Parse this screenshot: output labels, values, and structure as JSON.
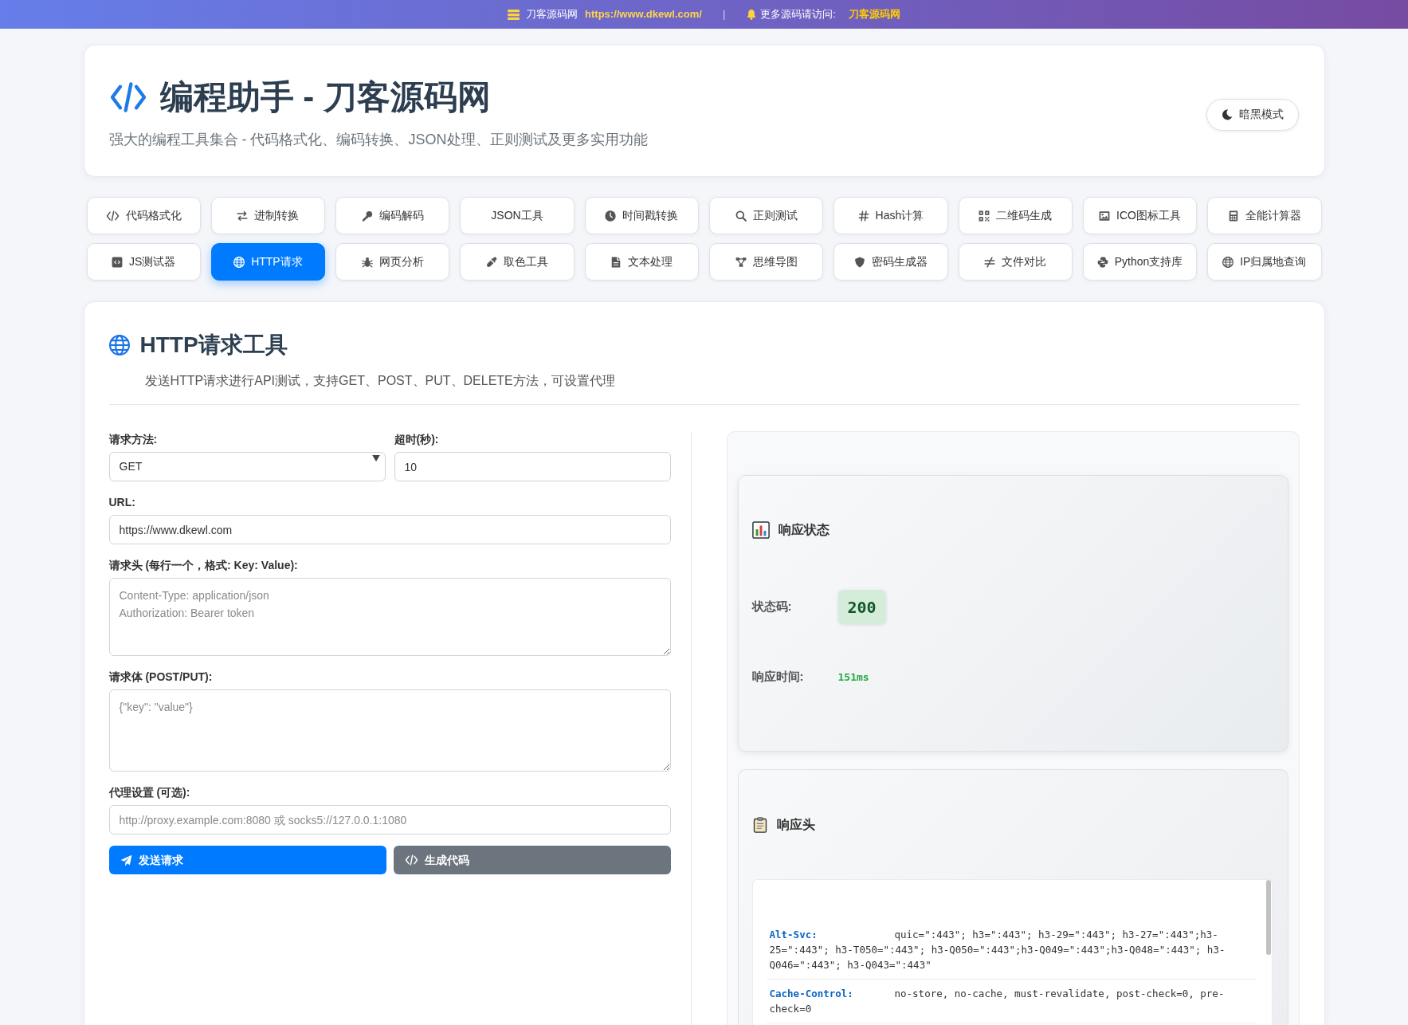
{
  "top_banner": {
    "site_name": "刀客源码网",
    "site_url": "https://www.dkewl.com/",
    "separator": "|",
    "more_label": "更多源码请访问:",
    "more_site": "刀客源码网"
  },
  "header": {
    "title": "编程助手 - 刀客源码网",
    "subtitle": "强大的编程工具集合 - 代码格式化、编码转换、JSON处理、正则测试及更多实用功能",
    "theme_button": "暗黑模式"
  },
  "tabs": [
    {
      "label": "代码格式化",
      "selected": false
    },
    {
      "label": "进制转换",
      "selected": false
    },
    {
      "label": "编码解码",
      "selected": false
    },
    {
      "label": "JSON工具",
      "selected": false
    },
    {
      "label": "时间戳转换",
      "selected": false
    },
    {
      "label": "正则测试",
      "selected": false
    },
    {
      "label": "Hash计算",
      "selected": false
    },
    {
      "label": "二维码生成",
      "selected": false
    },
    {
      "label": "ICO图标工具",
      "selected": false
    },
    {
      "label": "全能计算器",
      "selected": false
    },
    {
      "label": "JS测试器",
      "selected": false
    },
    {
      "label": "HTTP请求",
      "selected": true
    },
    {
      "label": "网页分析",
      "selected": false
    },
    {
      "label": "取色工具",
      "selected": false
    },
    {
      "label": "文本处理",
      "selected": false
    },
    {
      "label": "思维导图",
      "selected": false
    },
    {
      "label": "密码生成器",
      "selected": false
    },
    {
      "label": "文件对比",
      "selected": false
    },
    {
      "label": "Python支持库",
      "selected": false
    },
    {
      "label": "IP归属地查询",
      "selected": false
    }
  ],
  "tool": {
    "title": "HTTP请求工具",
    "description": "发送HTTP请求进行API测试，支持GET、POST、PUT、DELETE方法，可设置代理"
  },
  "form": {
    "method": {
      "label": "请求方法:",
      "value": "GET"
    },
    "timeout": {
      "label": "超时(秒):",
      "value": "10"
    },
    "url": {
      "label": "URL:",
      "value": "https://www.dkewl.com"
    },
    "headers": {
      "label": "请求头 (每行一个，格式: Key: Value):",
      "placeholder": "Content-Type: application/json\nAuthorization: Bearer token"
    },
    "body": {
      "label": "请求体 (POST/PUT):",
      "placeholder": "{\"key\": \"value\"}"
    },
    "proxy": {
      "label": "代理设置 (可选):",
      "placeholder": "http://proxy.example.com:8080 或 socks5://127.0.0.1:1080"
    },
    "send_button": "发送请求",
    "code_button": "生成代码"
  },
  "response": {
    "status": {
      "title": "响应状态",
      "code_label": "状态码:",
      "code": "200",
      "time_label": "响应时间:",
      "time": "151ms"
    },
    "headers": {
      "title": "响应头",
      "rows": [
        {
          "key": "Alt-Svc:",
          "value": "quic=\":443\"; h3=\":443\"; h3-29=\":443\"; h3-27=\":443\";h3-25=\":443\"; h3-T050=\":443\"; h3-Q050=\":443\";h3-Q049=\":443\";h3-Q048=\":443\"; h3-Q046=\":443\"; h3-Q043=\":443\""
        },
        {
          "key": "Cache-Control:",
          "value": "no-store, no-cache, must-revalidate, post-check=0, pre-check=0"
        }
      ]
    }
  }
}
